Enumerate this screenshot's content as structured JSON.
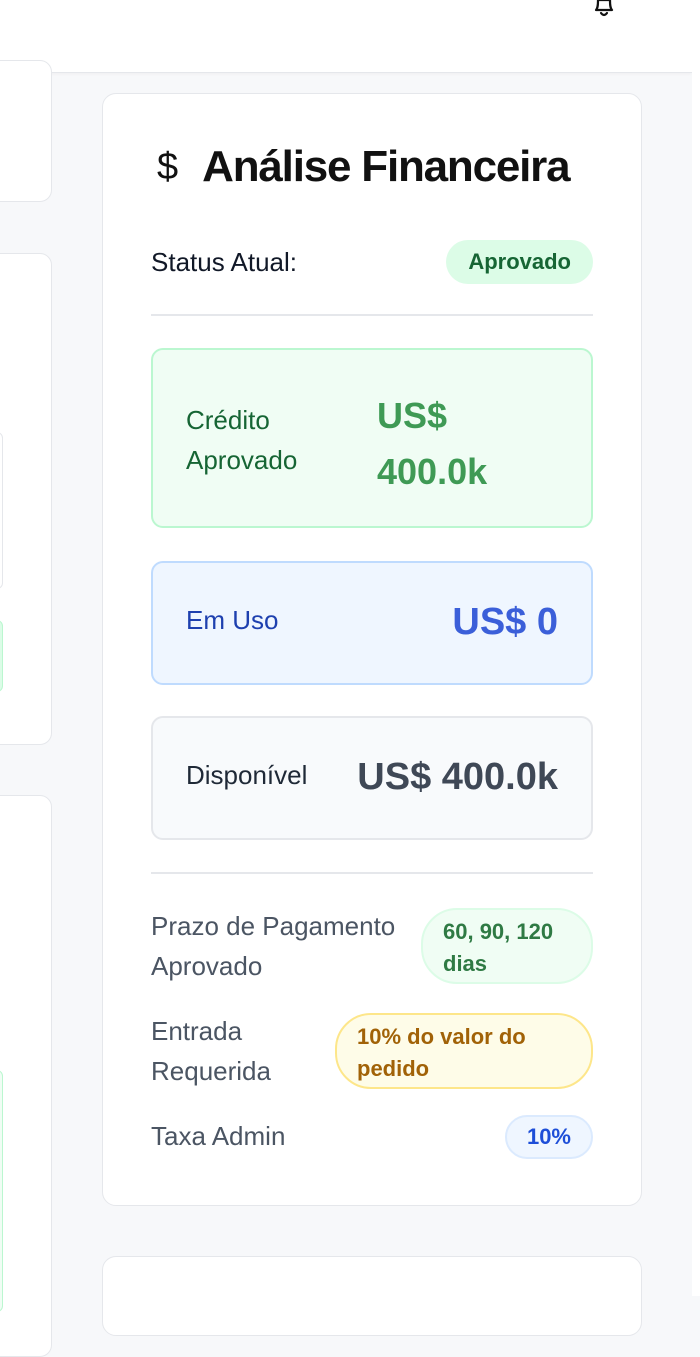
{
  "header": {
    "notification_icon": "bell-icon"
  },
  "finance_card": {
    "title_icon": "dollar-icon",
    "icon_glyph": "$",
    "title": "Análise Financeira",
    "status_label": "Status Atual:",
    "status_value": "Aprovado",
    "credit_label": "Crédito Aprovado",
    "credit_value": "US$ 400.0k",
    "in_use_label": "Em Uso",
    "in_use_value": "US$ 0",
    "available_label": "Disponível",
    "available_value": "US$ 400.0k",
    "payment_term_label": "Prazo de Pagamento Aprovado",
    "payment_term_value": "60, 90, 120 dias",
    "down_payment_label": "Entrada Requerida",
    "down_payment_value": "10% do valor do pedido",
    "admin_fee_label": "Taxa Admin",
    "admin_fee_value": "10%"
  },
  "colors": {
    "approved_green": "#166534",
    "credit_green": "#3f9a55",
    "in_use_blue": "#3b5fd9",
    "available_gray": "#3f4856",
    "down_payment_amber": "#a16207"
  }
}
